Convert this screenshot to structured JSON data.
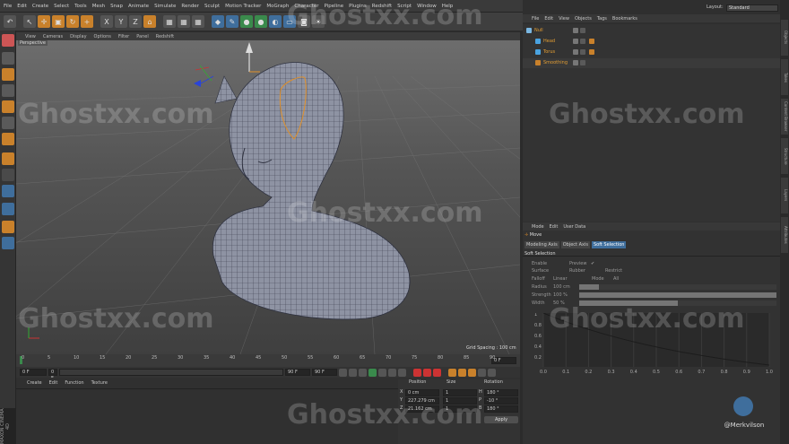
{
  "menu": [
    "File",
    "Edit",
    "Create",
    "Select",
    "Tools",
    "Mesh",
    "Snap",
    "Animate",
    "Simulate",
    "Render",
    "Sculpt",
    "Motion Tracker",
    "MoGraph",
    "Character",
    "Pipeline",
    "Plugins",
    "Redshift",
    "Script",
    "Window",
    "Help"
  ],
  "layout": {
    "label": "Layout:",
    "value": "Standard"
  },
  "toolbar": {
    "undo_label": "↶",
    "x_axis": "X",
    "y_axis": "Y",
    "z_axis": "Z"
  },
  "viewport": {
    "menu": [
      "View",
      "Cameras",
      "Display",
      "Options",
      "Filter",
      "Panel",
      "Redshift"
    ],
    "camera_label": "Perspective",
    "grid_spacing": "Grid Spacing : 100 cm"
  },
  "timeline": {
    "ticks": [
      "0",
      "5",
      "10",
      "15",
      "20",
      "25",
      "30",
      "35",
      "40",
      "45",
      "50",
      "55",
      "60",
      "65",
      "70",
      "75",
      "80",
      "85",
      "90"
    ],
    "end_field": "0 F"
  },
  "transport": {
    "current_frame": "0 F",
    "start_frame": "0 F",
    "end_frame_a": "90 F",
    "end_frame_b": "90 F"
  },
  "material_manager": {
    "menu": [
      "Create",
      "Edit",
      "Function",
      "Texture"
    ]
  },
  "brand": "MAXON CINEMA 4D",
  "coordinates": {
    "headers": [
      "Position",
      "Size",
      "Rotation"
    ],
    "rows": [
      {
        "axis": "X",
        "pos": "0 cm",
        "size": "1",
        "rot_axis": "H",
        "rot": "180 °"
      },
      {
        "axis": "Y",
        "pos": "227.279 cm",
        "size": "1",
        "rot_axis": "P",
        "rot": "-10 °"
      },
      {
        "axis": "Z",
        "pos": "21.162 cm",
        "size": "1",
        "rot_axis": "B",
        "rot": "180 °"
      }
    ],
    "apply_label": "Apply"
  },
  "object_manager": {
    "menu": [
      "File",
      "Edit",
      "View",
      "Objects",
      "Tags",
      "Bookmarks"
    ],
    "objects": [
      {
        "name": "Null",
        "indent": 0,
        "color": "#7ab7e2"
      },
      {
        "name": "Head",
        "indent": 1,
        "color": "#4aa3e0"
      },
      {
        "name": "Torus",
        "indent": 1,
        "color": "#4aa3e0"
      },
      {
        "name": "Smoothing",
        "indent": 1,
        "color": "#c9812b"
      }
    ]
  },
  "attributes": {
    "menu": [
      "Mode",
      "Edit",
      "User Data"
    ],
    "tool_name": "Move",
    "tabs": [
      "Modeling Axis",
      "Object Axis",
      "Soft Selection"
    ],
    "active_tab": "Soft Selection",
    "section": "Soft Selection",
    "params": [
      {
        "label": "Enable",
        "value": ""
      },
      {
        "label": "Preview",
        "value": "✔"
      },
      {
        "label": "Surface",
        "value": ""
      },
      {
        "label": "Rubber",
        "value": ""
      },
      {
        "label": "Restrict",
        "value": ""
      },
      {
        "label": "Falloff",
        "value": "Linear"
      },
      {
        "label": "Mode",
        "value": "All"
      },
      {
        "label": "Radius",
        "value": "100 cm"
      },
      {
        "label": "Strength",
        "value": "100 %"
      },
      {
        "label": "Width",
        "value": "50 %"
      }
    ],
    "radius_level": 0.1,
    "strength_level": 1.0,
    "width_level": 0.5,
    "curve_y_ticks": [
      "1",
      "0.8",
      "0.6",
      "0.4",
      "0.2"
    ],
    "curve_x_ticks": [
      "0.0",
      "0.1",
      "0.2",
      "0.3",
      "0.4",
      "0.5",
      "0.6",
      "0.7",
      "0.8",
      "0.9",
      "1.0"
    ]
  },
  "watermark": "Ghostxx.com",
  "credit": "@Merkvilson",
  "right_tabs": [
    "Objects",
    "Takes",
    "Content Browser",
    "Structure",
    "Layers",
    "Attributes"
  ]
}
